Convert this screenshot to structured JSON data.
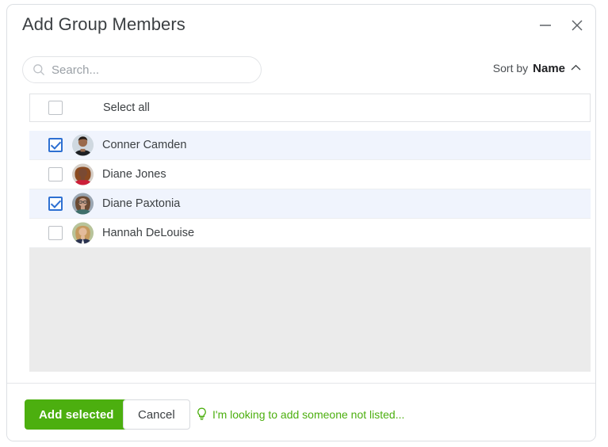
{
  "dialog": {
    "title": "Add Group Members",
    "minimize_label": "minimize",
    "close_label": "close"
  },
  "search": {
    "value": "",
    "placeholder": "Search...",
    "icon": "search-icon"
  },
  "sort": {
    "label": "Sort by",
    "value": "Name",
    "direction_icon": "chevron-up-icon"
  },
  "select_all": {
    "label": "Select all",
    "checked": false
  },
  "members": [
    {
      "name": "Conner Camden",
      "checked": true,
      "avatar": "avatar-conner-camden"
    },
    {
      "name": "Diane Jones",
      "checked": false,
      "avatar": "avatar-diane-jones"
    },
    {
      "name": "Diane Paxtonia",
      "checked": true,
      "avatar": "avatar-diane-paxtonia"
    },
    {
      "name": "Hannah DeLouise",
      "checked": false,
      "avatar": "avatar-hannah-delouise"
    }
  ],
  "footer": {
    "primary_label": "Add selected",
    "secondary_label": "Cancel",
    "hint_label": "I'm looking to add someone not listed...",
    "hint_icon": "lightbulb-icon"
  },
  "colors": {
    "primary_green": "#4caf0f",
    "checkbox_blue": "#2e70d2",
    "selected_row": "#f0f4fd",
    "filler_gray": "#ebebeb",
    "text": "#3c4043"
  }
}
